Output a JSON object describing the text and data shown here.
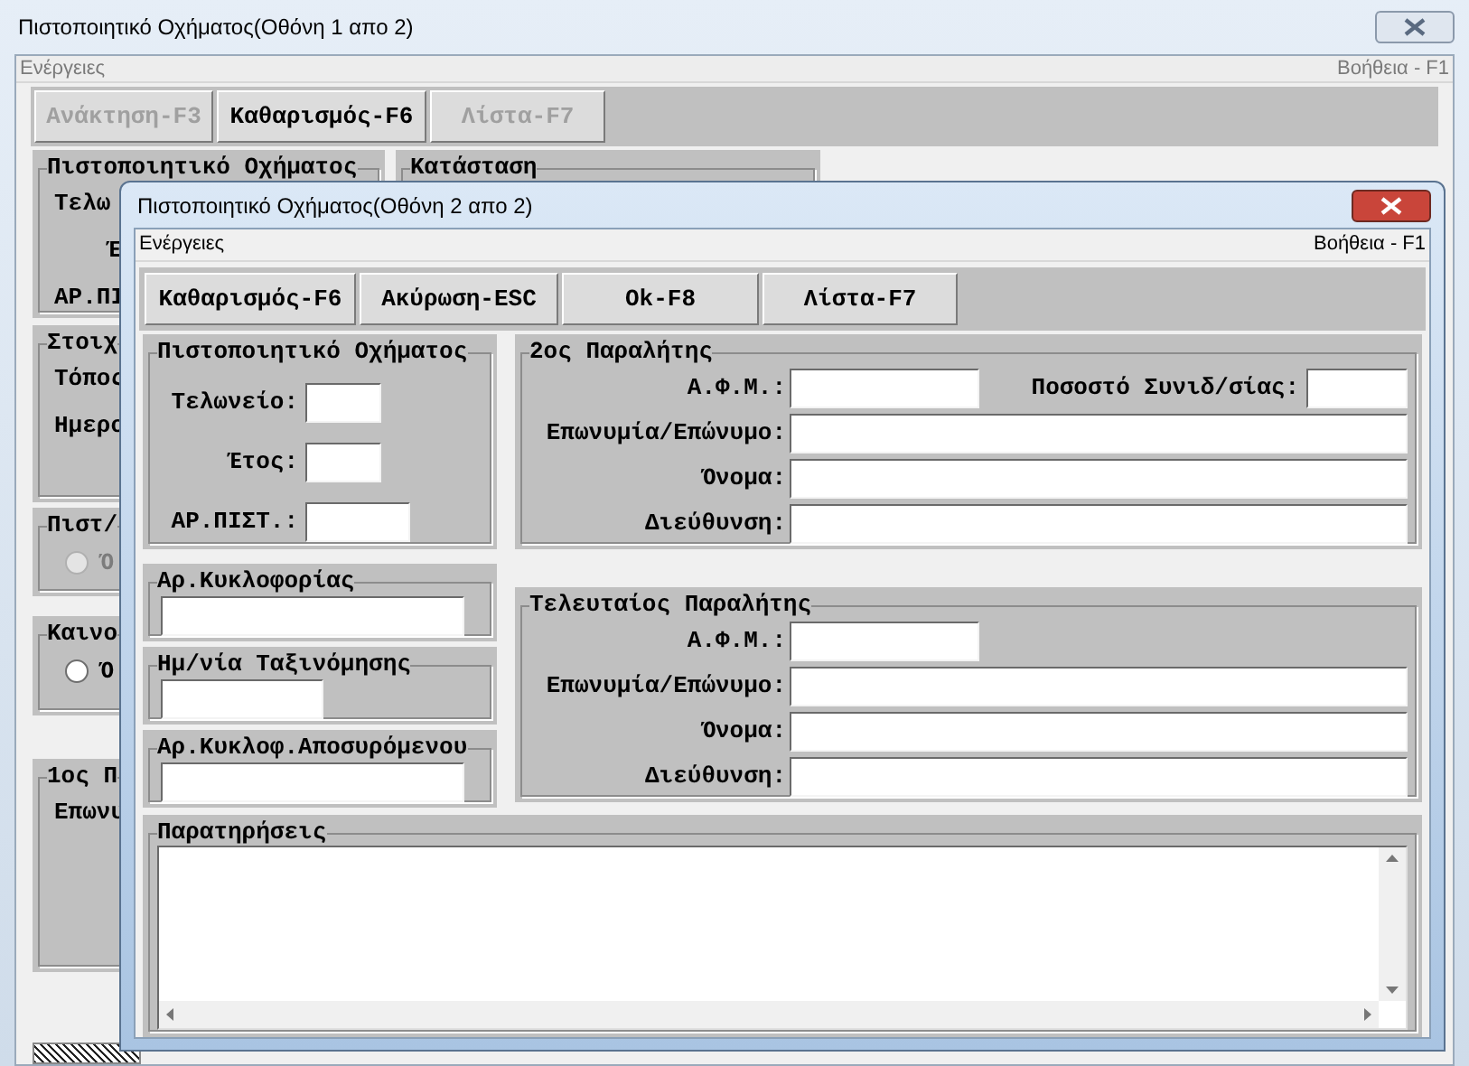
{
  "background_window": {
    "title": "Πιστοποιητικό Οχήματος(Οθόνη 1 απο 2)",
    "menu": "Ενέργειες",
    "help": "Βοήθεια - F1",
    "toolbar": [
      {
        "label": "Ανάκτηση-F3",
        "disabled": true
      },
      {
        "label": "Καθαρισμός-F6",
        "disabled": false
      },
      {
        "label": "Λίστα-F7",
        "disabled": true
      }
    ],
    "left_groups": [
      {
        "title": "Πιστοποιητικό Οχήματος",
        "items": [
          {
            "kind": "label",
            "text": "Τελω"
          },
          {
            "kind": "label",
            "text": "Έ"
          },
          {
            "kind": "label",
            "text": "ΑΡ.ΠΙ"
          }
        ]
      },
      {
        "title": "Στοιχ",
        "items": [
          {
            "kind": "label",
            "text": "Τόπος"
          },
          {
            "kind": "label",
            "text": "Ημερο"
          }
        ]
      },
      {
        "title": "Πιστ/",
        "items": [
          {
            "kind": "radio",
            "text": "Ό",
            "selected": false,
            "disabled": true
          }
        ]
      },
      {
        "title": "Καινο",
        "items": [
          {
            "kind": "radio",
            "text": "Ό",
            "selected": false,
            "disabled": false
          }
        ]
      },
      {
        "title": "1ος Π",
        "items": [
          {
            "kind": "label",
            "text": "Επωνυ"
          }
        ]
      }
    ],
    "status_group": {
      "title": "Κατάσταση"
    }
  },
  "dialog": {
    "title": "Πιστοποιητικό Οχήματος(Οθόνη 2 απο 2)",
    "menu": "Ενέργειες",
    "help": "Βοήθεια - F1",
    "toolbar": [
      {
        "label": "Καθαρισμός-F6",
        "disabled": false
      },
      {
        "label": "Ακύρωση-ESC",
        "disabled": false
      },
      {
        "label": "Ok-F8",
        "disabled": false
      },
      {
        "label": "Λίστα-F7",
        "disabled": false
      }
    ],
    "certificate": {
      "title": "Πιστοποιητικό Οχήματος",
      "fields": [
        "Τελωνείο:",
        "Έτος:",
        "ΑΡ.ΠΙΣΤ.:"
      ]
    },
    "side_groups": [
      {
        "title": "Αρ.Κυκλοφορίας"
      },
      {
        "title": "Ημ/νία Ταξινόμησης"
      },
      {
        "title": "Αρ.Κυκλοφ.Αποσυρόμενου"
      }
    ],
    "receivers": [
      {
        "title": "2ος Παραλήτης",
        "fields": [
          "Α.Φ.Μ.:",
          "Επωνυμία/Επώνυμο:",
          "Όνομα:",
          "Διεύθυνση:"
        ],
        "extra_field": "Ποσοστό Συνιδ/σίας:"
      },
      {
        "title": "Τελευταίος Παραλήτης",
        "fields": [
          "Α.Φ.Μ.:",
          "Επωνυμία/Επώνυμο:",
          "Όνομα:",
          "Διεύθυνση:"
        ]
      }
    ],
    "notes": {
      "title": "Παρατηρήσεις"
    }
  }
}
